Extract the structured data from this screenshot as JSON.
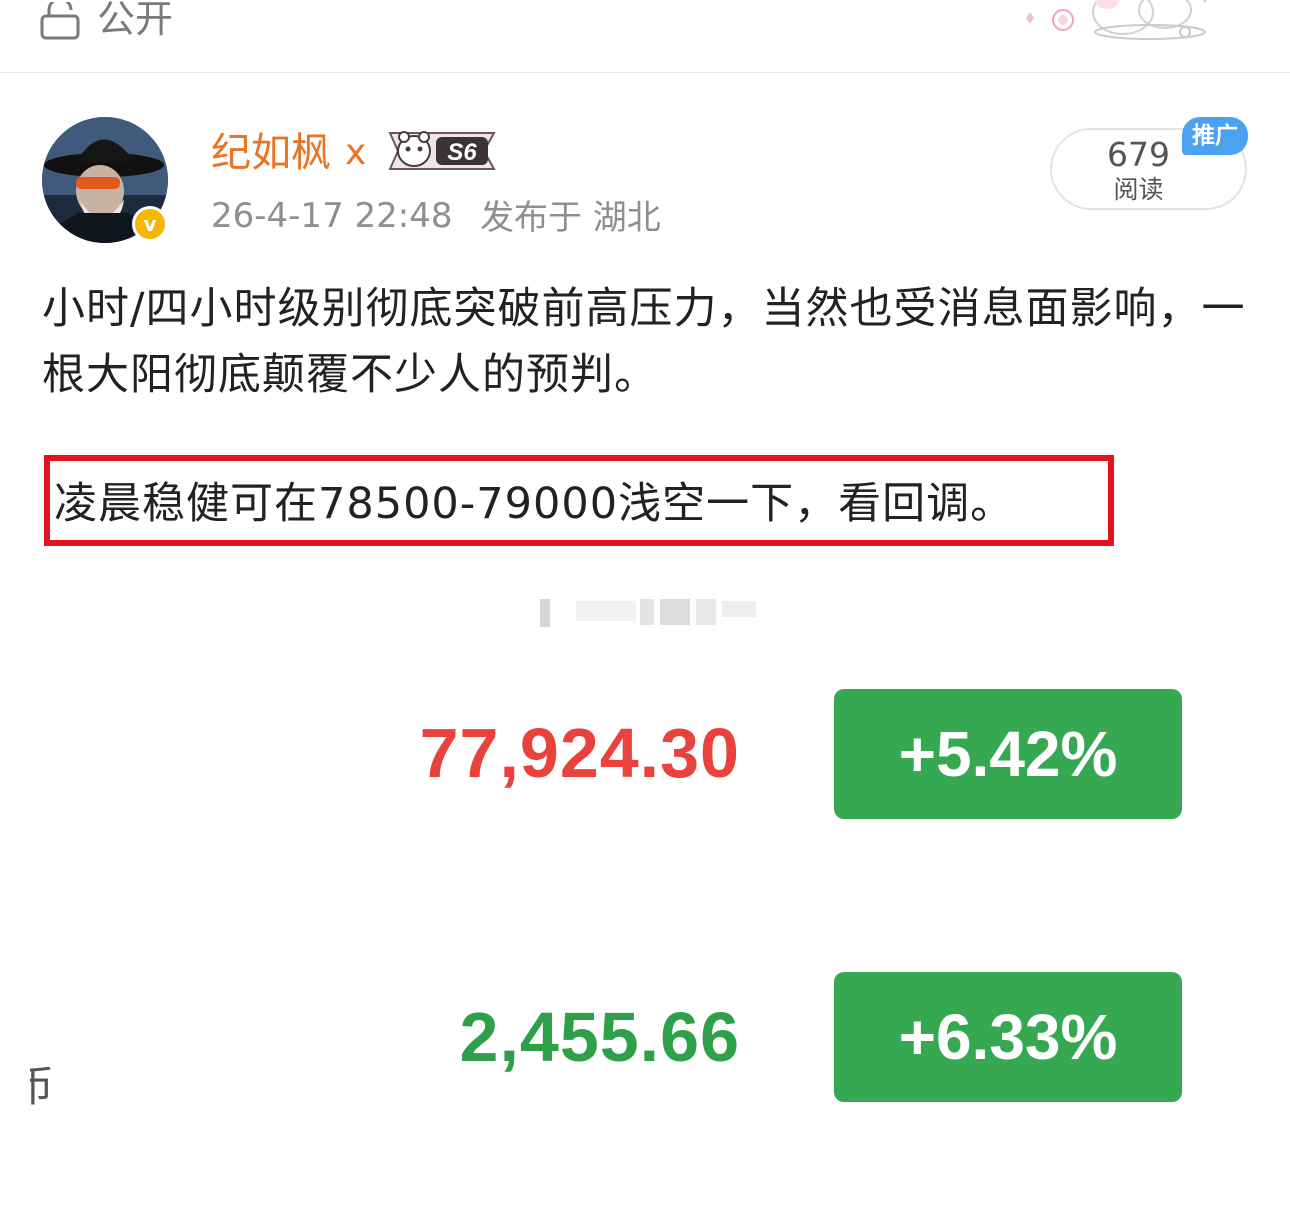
{
  "header": {
    "visibility_label": "公开"
  },
  "post": {
    "author": "纪如枫",
    "author_tag": "x",
    "medal_text": "S6",
    "time": "26-4-17 22:48",
    "location": "发布于 湖北",
    "read_count": "679",
    "read_label": "阅读",
    "promo_badge": "推广",
    "body": "小时/四小时级别彻底突破前高压力，当然也受消息面影响，一根大阳彻底颠覆不少人的预判。",
    "highlight": "凌晨稳健可在78500-79000浅空一下，看回调。"
  },
  "tickers": [
    {
      "price": "77,924.30",
      "change": "+5.42%",
      "price_color": "#e9423c"
    },
    {
      "price": "2,455.66",
      "change": "+6.33%",
      "price_color": "#2fa04a"
    }
  ],
  "edge_text": "币",
  "colors": {
    "accent": "#eb7325",
    "highlight_border": "#e5141c",
    "change_bg": "#36a852",
    "promo": "#4aa2f0"
  }
}
